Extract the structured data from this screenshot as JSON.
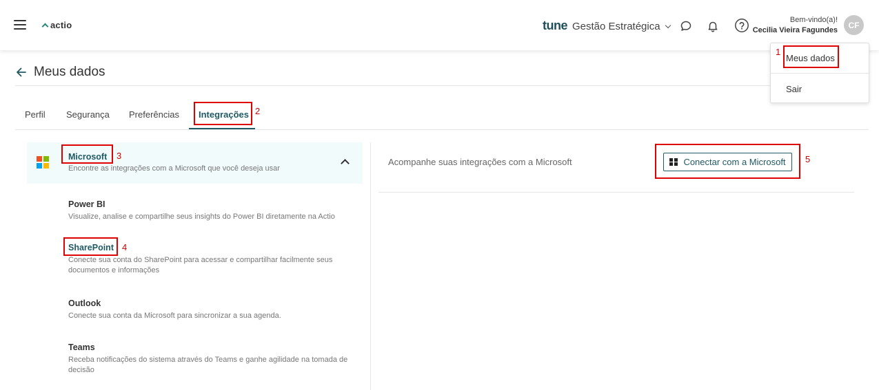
{
  "topbar": {
    "logo_text": "actio",
    "product_brand": "tune",
    "product_name": "Gestão Estratégica",
    "welcome": "Bem-vindo(a)!",
    "user_name": "Cecilia Vieira Fagundes",
    "avatar_initials": "CF",
    "icons": [
      "menu-icon",
      "chat-icon",
      "bell-icon",
      "help-icon"
    ]
  },
  "dropdown": {
    "items": [
      {
        "label": "Meus dados"
      },
      {
        "label": "Sair"
      }
    ]
  },
  "page": {
    "title": "Meus dados"
  },
  "tabs": [
    {
      "label": "Perfil"
    },
    {
      "label": "Segurança"
    },
    {
      "label": "Preferências"
    },
    {
      "label": "Integrações",
      "active": true
    }
  ],
  "integrations": {
    "provider": {
      "title": "Microsoft",
      "description": "Encontre as integrações com a Microsoft que você deseja usar",
      "logo_colors": [
        "#f25022",
        "#7fba00",
        "#00a4ef",
        "#ffb900"
      ]
    },
    "services": [
      {
        "title": "Power BI",
        "description": "Visualize, analise e compartilhe seus insights do Power BI diretamente na Actio"
      },
      {
        "title": "SharePoint",
        "description": "Conecte sua conta do SharePoint para acessar e compartilhar facilmente seus documentos e informações"
      },
      {
        "title": "Outlook",
        "description": "Conecte sua conta da Microsoft para sincronizar a sua agenda."
      },
      {
        "title": "Teams",
        "description": "Receba notificações do sistema através do Teams e ganhe agilidade na tomada de decisão"
      }
    ]
  },
  "right_panel": {
    "text": "Acompanhe suas integrações com a Microsoft",
    "connect_label": "Conectar com a Microsoft"
  },
  "annotations": [
    "1",
    "2",
    "3",
    "4",
    "5"
  ],
  "colors": {
    "accent": "#1f5964",
    "annotation": "#e00000",
    "header_bg": "#f2fbfc"
  }
}
